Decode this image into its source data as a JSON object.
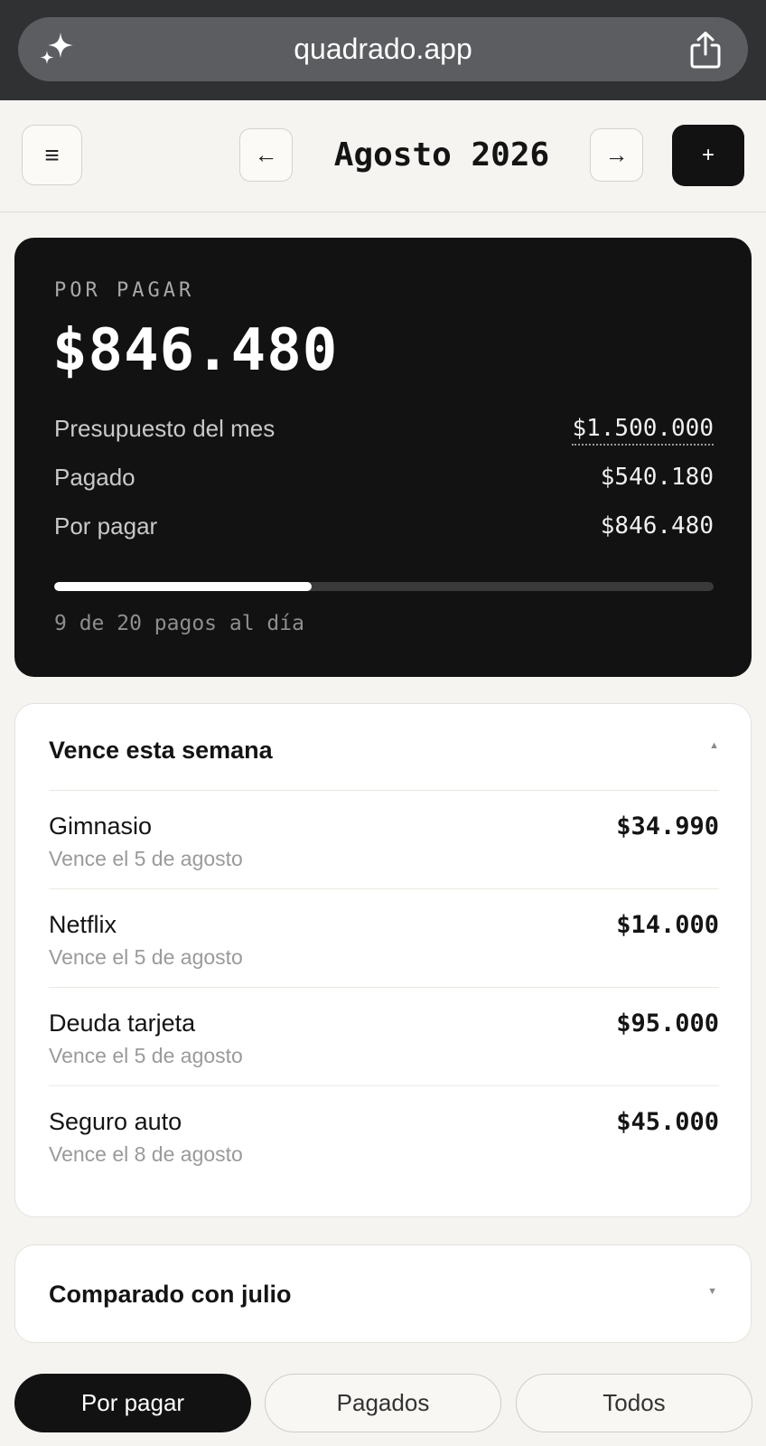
{
  "browser": {
    "url": "quadrado.app",
    "left_icon": "sparkle-icon",
    "right_icon": "share-icon"
  },
  "header": {
    "menu_glyph": "≡",
    "prev_glyph": "←",
    "next_glyph": "→",
    "title": "Agosto 2026",
    "add_glyph": "+"
  },
  "summary": {
    "label": "POR PAGAR",
    "amount": "$846.480",
    "stats": [
      {
        "label": "Presupuesto del mes",
        "value": "$1.500.000"
      },
      {
        "label": "Pagado",
        "value": "$540.180"
      },
      {
        "label": "Por pagar",
        "value": "$846.480"
      }
    ],
    "progress": {
      "paid": 9,
      "total": 20,
      "fraction": 0.39
    },
    "progress_caption": "9 de 20 pagos al día"
  },
  "week": {
    "title": "Vence esta semana",
    "caret": "▲",
    "bills": [
      {
        "name": "Gimnasio",
        "due": "Vence el 5 de agosto",
        "amount": "$34.990"
      },
      {
        "name": "Netflix",
        "due": "Vence el 5 de agosto",
        "amount": "$14.000"
      },
      {
        "name": "Deuda tarjeta",
        "due": "Vence el 5 de agosto",
        "amount": "$95.000"
      },
      {
        "name": "Seguro auto",
        "due": "Vence el 8 de agosto",
        "amount": "$45.000"
      }
    ]
  },
  "compare": {
    "title": "Comparado con julio",
    "caret": "▼"
  },
  "filters": [
    {
      "label": "Por pagar",
      "active": true
    },
    {
      "label": "Pagados",
      "active": false
    },
    {
      "label": "Todos",
      "active": false
    }
  ],
  "colors": {
    "background": "#f5f4f0",
    "card_dark": "#121212",
    "accent": "#121212",
    "muted_text": "#9a9a9a"
  }
}
